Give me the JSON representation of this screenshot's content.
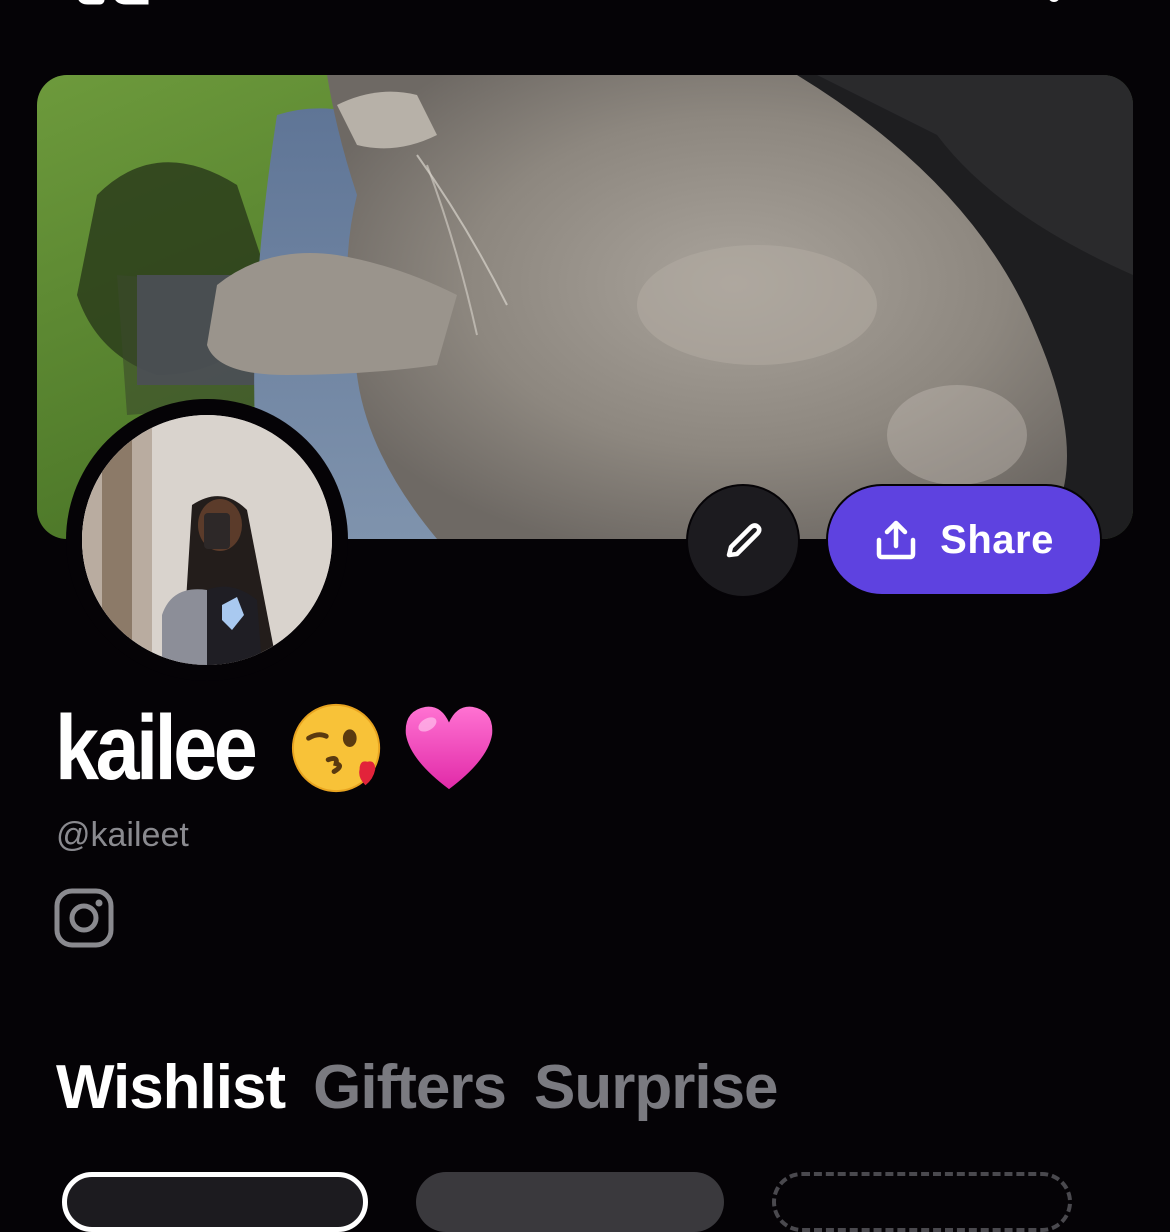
{
  "icons": {
    "back": "back-icon",
    "more": "more-icon",
    "edit": "pencil-icon",
    "share": "share-icon",
    "instagram": "instagram-icon"
  },
  "profile": {
    "display_name": "kailee",
    "emojis": [
      "kissing-face-with-heart",
      "pink-heart"
    ],
    "handle": "@kaileet"
  },
  "actions": {
    "share_label": "Share"
  },
  "tabs": [
    {
      "label": "Wishlist",
      "active": true
    },
    {
      "label": "Gifters",
      "active": false
    },
    {
      "label": "Surprise",
      "active": false
    }
  ],
  "colors": {
    "background": "#050306",
    "accent": "#5e42e0",
    "muted_text": "#8a8a8f",
    "inactive_tab": "#7a7a80",
    "edit_button": "#1c1b1f"
  }
}
